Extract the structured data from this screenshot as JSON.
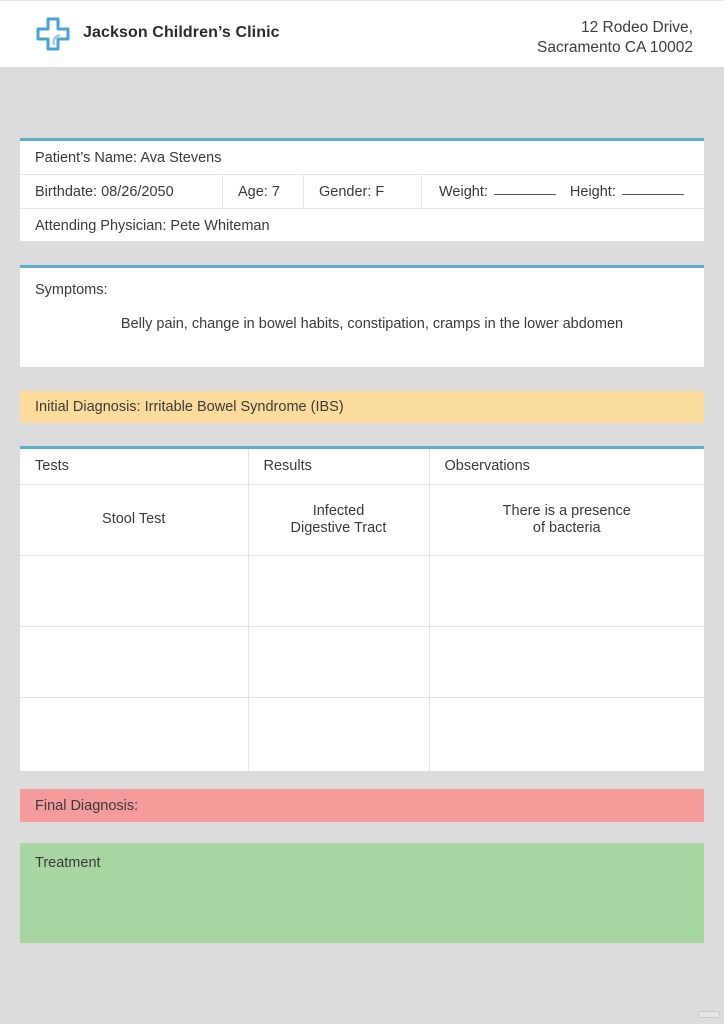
{
  "header": {
    "logo_icon": "medical-cross-icon",
    "clinic_name": "Jackson Children’s Clinic",
    "address_line1": "12 Rodeo Drive,",
    "address_line2": "Sacramento CA 10002"
  },
  "patient": {
    "name": "Patient’s Name: Ava Stevens",
    "birthdate": "Birthdate: 08/26/2050",
    "age": "Age: 7",
    "gender": "Gender: F",
    "weight_label": "Weight:",
    "weight_value": "",
    "height_label": "Height:",
    "height_value": "",
    "physician": "Attending Physician: Pete Whiteman"
  },
  "symptoms": {
    "label": "Symptoms:",
    "text": "Belly pain, change in bowel habits, constipation, cramps in the lower abdomen"
  },
  "initial_diagnosis": "Initial Diagnosis: Irritable Bowel Syndrome (IBS)",
  "tests_table": {
    "headers": [
      "Tests",
      "Results",
      "Observations"
    ],
    "rows": [
      [
        "Stool Test",
        "Infected Digestive Tract",
        "There is a presence of bacteria"
      ],
      [
        "",
        "",
        ""
      ],
      [
        "",
        "",
        ""
      ],
      [
        "",
        "",
        ""
      ]
    ]
  },
  "final_diagnosis": "Final Diagnosis:",
  "treatment": "Treatment",
  "colors": {
    "accent_line": "#5ab0c8",
    "initial_diagnosis_bg": "#fcdc9c",
    "final_diagnosis_bg": "#f59b9b",
    "treatment_bg": "#a7d7a0"
  }
}
